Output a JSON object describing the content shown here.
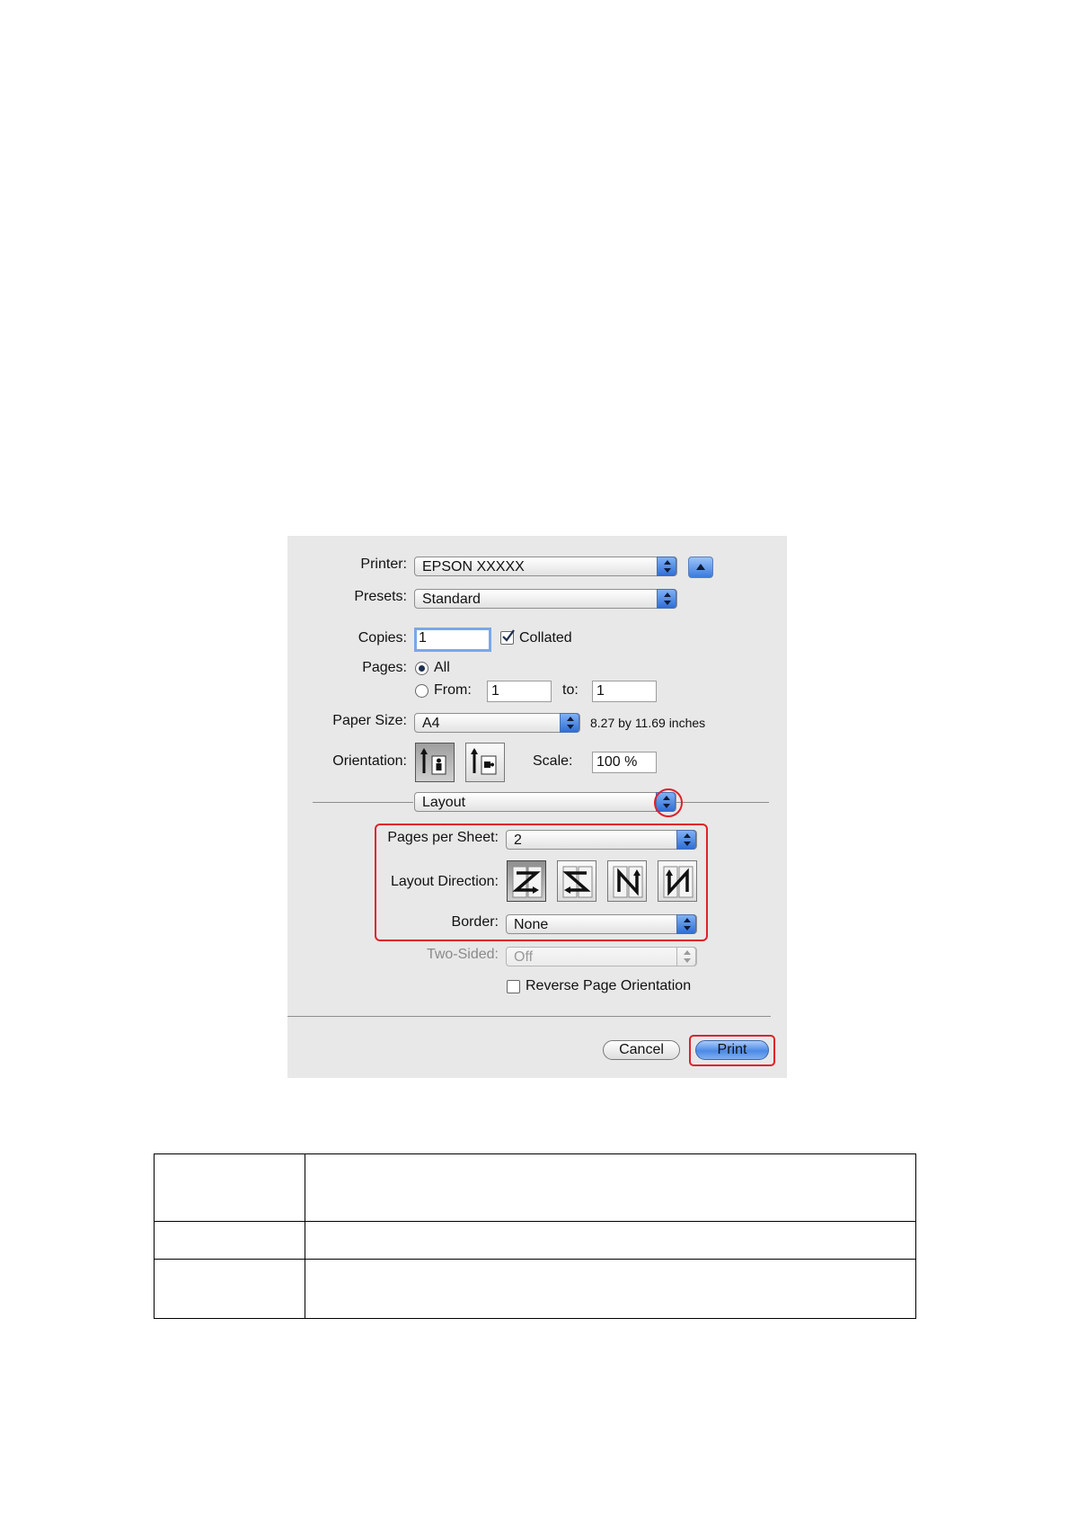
{
  "dialog": {
    "printer": {
      "label": "Printer:",
      "value": "EPSON XXXXX"
    },
    "presets": {
      "label": "Presets:",
      "value": "Standard"
    },
    "copies": {
      "label": "Copies:",
      "value": "1",
      "collated_label": "Collated",
      "collated_checked": true
    },
    "pages": {
      "label": "Pages:",
      "all_label": "All",
      "from_label": "From:",
      "from_value": "1",
      "to_label": "to:",
      "to_value": "1",
      "selected": "All"
    },
    "paper_size": {
      "label": "Paper Size:",
      "value": "A4",
      "dimensions": "8.27 by 11.69 inches"
    },
    "orientation": {
      "label": "Orientation:",
      "selected": "portrait"
    },
    "scale": {
      "label": "Scale:",
      "value": "100 %"
    },
    "panel": {
      "value": "Layout"
    },
    "layout": {
      "pages_per_sheet": {
        "label": "Pages per Sheet:",
        "value": "2"
      },
      "layout_direction": {
        "label": "Layout Direction:",
        "selected_index": 0
      },
      "border": {
        "label": "Border:",
        "value": "None"
      },
      "two_sided": {
        "label": "Two-Sided:",
        "value": "Off",
        "enabled": false
      },
      "reverse_page_orientation": {
        "label": "Reverse Page Orientation",
        "checked": false
      }
    },
    "buttons": {
      "cancel": "Cancel",
      "print": "Print"
    }
  },
  "colors": {
    "highlight": "#e0202a",
    "accent_blue": "#3a78dc",
    "dialog_bg": "#e8e8e8"
  },
  "table": {
    "rows": [
      [
        "",
        ""
      ],
      [
        "",
        ""
      ],
      [
        "",
        ""
      ]
    ]
  }
}
